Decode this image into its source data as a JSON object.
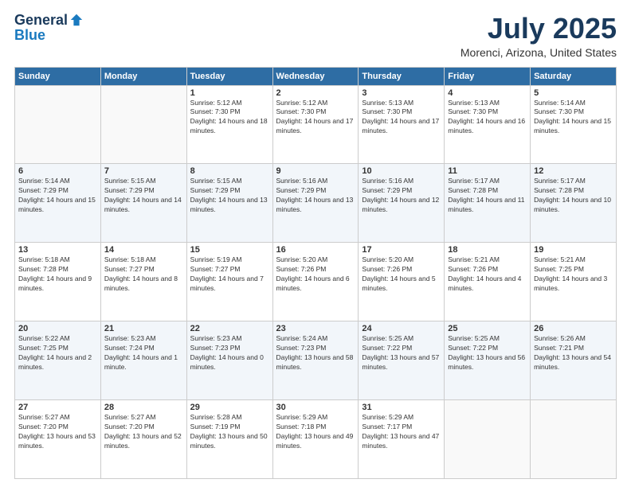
{
  "header": {
    "logo_general": "General",
    "logo_blue": "Blue",
    "month": "July 2025",
    "location": "Morenci, Arizona, United States"
  },
  "weekdays": [
    "Sunday",
    "Monday",
    "Tuesday",
    "Wednesday",
    "Thursday",
    "Friday",
    "Saturday"
  ],
  "weeks": [
    [
      {
        "day": "",
        "info": ""
      },
      {
        "day": "",
        "info": ""
      },
      {
        "day": "1",
        "info": "Sunrise: 5:12 AM\nSunset: 7:30 PM\nDaylight: 14 hours and 18 minutes."
      },
      {
        "day": "2",
        "info": "Sunrise: 5:12 AM\nSunset: 7:30 PM\nDaylight: 14 hours and 17 minutes."
      },
      {
        "day": "3",
        "info": "Sunrise: 5:13 AM\nSunset: 7:30 PM\nDaylight: 14 hours and 17 minutes."
      },
      {
        "day": "4",
        "info": "Sunrise: 5:13 AM\nSunset: 7:30 PM\nDaylight: 14 hours and 16 minutes."
      },
      {
        "day": "5",
        "info": "Sunrise: 5:14 AM\nSunset: 7:30 PM\nDaylight: 14 hours and 15 minutes."
      }
    ],
    [
      {
        "day": "6",
        "info": "Sunrise: 5:14 AM\nSunset: 7:29 PM\nDaylight: 14 hours and 15 minutes."
      },
      {
        "day": "7",
        "info": "Sunrise: 5:15 AM\nSunset: 7:29 PM\nDaylight: 14 hours and 14 minutes."
      },
      {
        "day": "8",
        "info": "Sunrise: 5:15 AM\nSunset: 7:29 PM\nDaylight: 14 hours and 13 minutes."
      },
      {
        "day": "9",
        "info": "Sunrise: 5:16 AM\nSunset: 7:29 PM\nDaylight: 14 hours and 13 minutes."
      },
      {
        "day": "10",
        "info": "Sunrise: 5:16 AM\nSunset: 7:29 PM\nDaylight: 14 hours and 12 minutes."
      },
      {
        "day": "11",
        "info": "Sunrise: 5:17 AM\nSunset: 7:28 PM\nDaylight: 14 hours and 11 minutes."
      },
      {
        "day": "12",
        "info": "Sunrise: 5:17 AM\nSunset: 7:28 PM\nDaylight: 14 hours and 10 minutes."
      }
    ],
    [
      {
        "day": "13",
        "info": "Sunrise: 5:18 AM\nSunset: 7:28 PM\nDaylight: 14 hours and 9 minutes."
      },
      {
        "day": "14",
        "info": "Sunrise: 5:18 AM\nSunset: 7:27 PM\nDaylight: 14 hours and 8 minutes."
      },
      {
        "day": "15",
        "info": "Sunrise: 5:19 AM\nSunset: 7:27 PM\nDaylight: 14 hours and 7 minutes."
      },
      {
        "day": "16",
        "info": "Sunrise: 5:20 AM\nSunset: 7:26 PM\nDaylight: 14 hours and 6 minutes."
      },
      {
        "day": "17",
        "info": "Sunrise: 5:20 AM\nSunset: 7:26 PM\nDaylight: 14 hours and 5 minutes."
      },
      {
        "day": "18",
        "info": "Sunrise: 5:21 AM\nSunset: 7:26 PM\nDaylight: 14 hours and 4 minutes."
      },
      {
        "day": "19",
        "info": "Sunrise: 5:21 AM\nSunset: 7:25 PM\nDaylight: 14 hours and 3 minutes."
      }
    ],
    [
      {
        "day": "20",
        "info": "Sunrise: 5:22 AM\nSunset: 7:25 PM\nDaylight: 14 hours and 2 minutes."
      },
      {
        "day": "21",
        "info": "Sunrise: 5:23 AM\nSunset: 7:24 PM\nDaylight: 14 hours and 1 minute."
      },
      {
        "day": "22",
        "info": "Sunrise: 5:23 AM\nSunset: 7:23 PM\nDaylight: 14 hours and 0 minutes."
      },
      {
        "day": "23",
        "info": "Sunrise: 5:24 AM\nSunset: 7:23 PM\nDaylight: 13 hours and 58 minutes."
      },
      {
        "day": "24",
        "info": "Sunrise: 5:25 AM\nSunset: 7:22 PM\nDaylight: 13 hours and 57 minutes."
      },
      {
        "day": "25",
        "info": "Sunrise: 5:25 AM\nSunset: 7:22 PM\nDaylight: 13 hours and 56 minutes."
      },
      {
        "day": "26",
        "info": "Sunrise: 5:26 AM\nSunset: 7:21 PM\nDaylight: 13 hours and 54 minutes."
      }
    ],
    [
      {
        "day": "27",
        "info": "Sunrise: 5:27 AM\nSunset: 7:20 PM\nDaylight: 13 hours and 53 minutes."
      },
      {
        "day": "28",
        "info": "Sunrise: 5:27 AM\nSunset: 7:20 PM\nDaylight: 13 hours and 52 minutes."
      },
      {
        "day": "29",
        "info": "Sunrise: 5:28 AM\nSunset: 7:19 PM\nDaylight: 13 hours and 50 minutes."
      },
      {
        "day": "30",
        "info": "Sunrise: 5:29 AM\nSunset: 7:18 PM\nDaylight: 13 hours and 49 minutes."
      },
      {
        "day": "31",
        "info": "Sunrise: 5:29 AM\nSunset: 7:17 PM\nDaylight: 13 hours and 47 minutes."
      },
      {
        "day": "",
        "info": ""
      },
      {
        "day": "",
        "info": ""
      }
    ]
  ]
}
